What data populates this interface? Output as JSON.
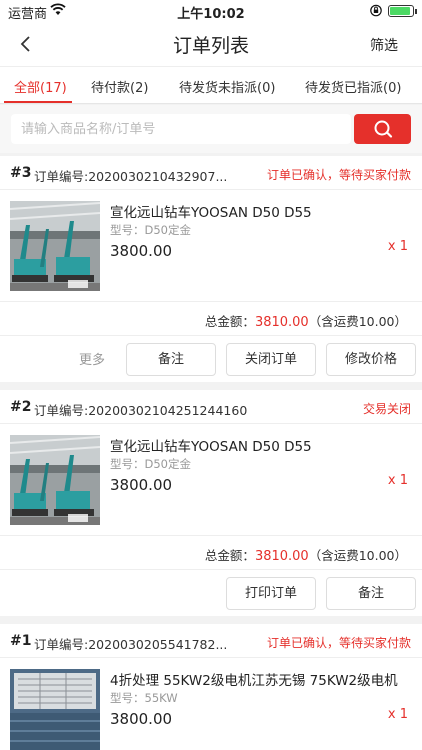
{
  "status_bar": {
    "carrier": "运营商",
    "time": "上午10:02"
  },
  "nav": {
    "title": "订单列表",
    "filter": "筛选"
  },
  "tabs": [
    {
      "label": "全部(17)",
      "active": true
    },
    {
      "label": "待付款(2)"
    },
    {
      "label": "待发货未指派(0)"
    },
    {
      "label": "待发货已指派(0)"
    }
  ],
  "search": {
    "placeholder": "请输入商品名称/订单号"
  },
  "orders": [
    {
      "num": "#3",
      "sn": "订单编号:2020030210432907...",
      "status": "订单已确认，等待买家付款",
      "product": {
        "name": "宣化远山钻车YOOSAN D50 D55",
        "model": "型号：D50定金",
        "price": "3800.00",
        "qty": "x 1"
      },
      "total_label": "总金额：",
      "total_amount": "3810.00",
      "total_suffix": "（含运费10.00）",
      "more": "更多",
      "buttons": [
        "备注",
        "关闭订单",
        "修改价格"
      ]
    },
    {
      "num": "#2",
      "sn": "订单编号:20200302104251244160",
      "status": "交易关闭",
      "product": {
        "name": "宣化远山钻车YOOSAN D50 D55",
        "model": "型号：D50定金",
        "price": "3800.00",
        "qty": "x 1"
      },
      "total_label": "总金额：",
      "total_amount": "3810.00",
      "total_suffix": "（含运费10.00）",
      "buttons": [
        "打印订单",
        "备注"
      ]
    },
    {
      "num": "#1",
      "sn": "订单编号:2020030205541782...",
      "status": "订单已确认，等待买家付款",
      "product": {
        "name": "4折处理 55KW2级电机江苏无锡 75KW2级电机",
        "model": "型号：55KW",
        "price": "3800.00",
        "qty": "x 1"
      }
    }
  ],
  "colors": {
    "accent": "#e5302b",
    "battery": "#4cd964"
  }
}
